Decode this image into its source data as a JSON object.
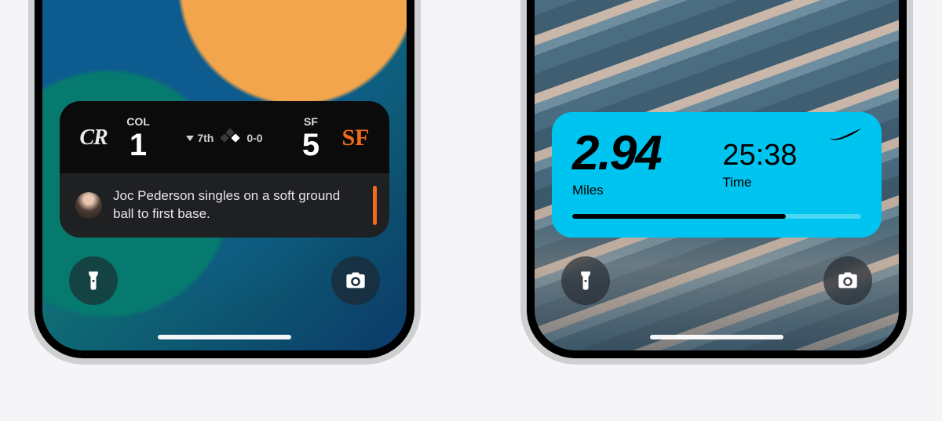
{
  "phone_left": {
    "sports": {
      "away_logo_text": "CR",
      "away_abbr": "COL",
      "away_score": "1",
      "inning_text": "7th",
      "count_text": "0-0",
      "home_abbr": "SF",
      "home_score": "5",
      "home_logo_text": "SF",
      "play_text": "Joc Pederson singles on a soft ground ball to first base.",
      "accent_color": "#f26b1a"
    },
    "controls": {
      "flashlight": "flashlight-icon",
      "camera": "camera-icon"
    }
  },
  "phone_right": {
    "nike": {
      "distance_value": "2.94",
      "distance_label": "Miles",
      "time_value": "25:38",
      "time_label": "Time",
      "progress_percent": 74,
      "accent_color": "#00c4f0"
    },
    "controls": {
      "flashlight": "flashlight-icon",
      "camera": "camera-icon"
    }
  }
}
